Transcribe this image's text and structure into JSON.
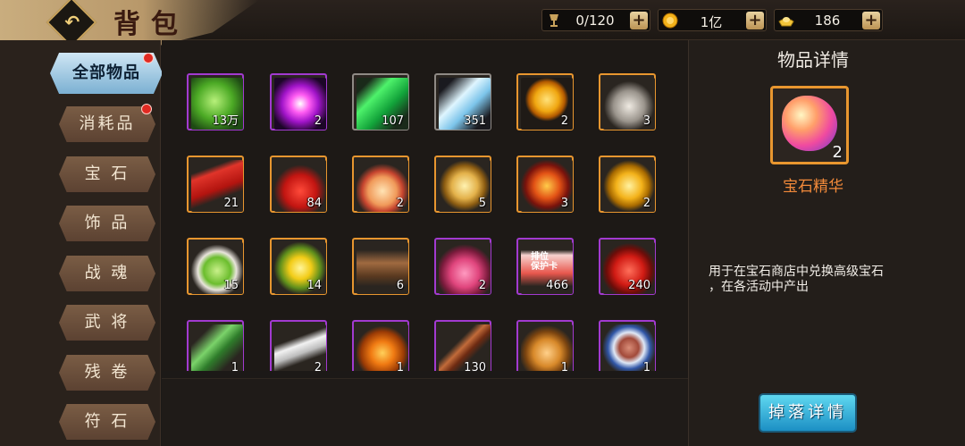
{
  "header": {
    "title": "背包",
    "back_icon": "back-arrow-icon",
    "resources": [
      {
        "icon": "trophy-icon",
        "value": "0/120",
        "color": "#c9a35c"
      },
      {
        "icon": "gold-coin-icon",
        "value": "1亿",
        "color": "#f3b21a"
      },
      {
        "icon": "ingot-icon",
        "value": "186",
        "color": "#f3c53a"
      }
    ],
    "plus_label": "+"
  },
  "sidebar": {
    "items": [
      {
        "label": "全部物品",
        "active": true,
        "badge": true
      },
      {
        "label": "消耗品",
        "active": false,
        "badge": true
      },
      {
        "label": "宝 石",
        "active": false,
        "badge": false
      },
      {
        "label": "饰 品",
        "active": false,
        "badge": false
      },
      {
        "label": "战 魂",
        "active": false,
        "badge": false
      },
      {
        "label": "武 将",
        "active": false,
        "badge": false
      },
      {
        "label": "残 卷",
        "active": false,
        "badge": false
      },
      {
        "label": "符 石",
        "active": false,
        "badge": false
      }
    ]
  },
  "inventory": {
    "rows": [
      [
        {
          "name": "green-beans-item",
          "count": "13万",
          "frame": "purple"
        },
        {
          "name": "purple-vortex-orb-item",
          "count": "2",
          "frame": "purple"
        },
        {
          "name": "green-emerald-item",
          "count": "107",
          "frame": "gray"
        },
        {
          "name": "blue-crystal-item",
          "count": "351",
          "frame": "gray"
        },
        {
          "name": "gold-medal-item",
          "count": "2",
          "frame": "orange"
        },
        {
          "name": "wine-jar-item",
          "count": "3",
          "frame": "orange"
        }
      ],
      [
        {
          "name": "couplets-item",
          "count": "21",
          "frame": "orange"
        },
        {
          "name": "firecrackers-item",
          "count": "84",
          "frame": "orange"
        },
        {
          "name": "birthday-cake-item",
          "count": "2",
          "frame": "orange"
        },
        {
          "name": "jade-pendant-item",
          "count": "5",
          "frame": "orange"
        },
        {
          "name": "dragon-lantern-item",
          "count": "3",
          "frame": "orange"
        },
        {
          "name": "chrysanthemum-item",
          "count": "2",
          "frame": "orange"
        }
      ],
      [
        {
          "name": "green-dumplings-item",
          "count": "15",
          "frame": "orange"
        },
        {
          "name": "lily-flower-item",
          "count": "14",
          "frame": "orange"
        },
        {
          "name": "shopping-cart-item",
          "count": "6",
          "frame": "orange"
        },
        {
          "name": "pink-pouch-item",
          "count": "2",
          "frame": "purple"
        },
        {
          "name": "rank-protect-card-item",
          "count": "466",
          "frame": "purple",
          "label": "排位\n保护卡"
        },
        {
          "name": "red-treasure-bag-item",
          "count": "240",
          "frame": "purple"
        }
      ],
      [
        {
          "name": "bamboo-leaves-item",
          "count": "1",
          "frame": "purple"
        },
        {
          "name": "white-sticks-item",
          "count": "2",
          "frame": "purple"
        },
        {
          "name": "jack-o-lantern-item",
          "count": "1",
          "frame": "purple"
        },
        {
          "name": "wooden-staff-item",
          "count": "130",
          "frame": "purple"
        },
        {
          "name": "roast-chicken-item",
          "count": "1",
          "frame": "purple"
        },
        {
          "name": "porridge-bowl-item",
          "count": "1",
          "frame": "purple"
        }
      ]
    ]
  },
  "detail": {
    "title": "物品详情",
    "item_icon": "gem-essence-icon",
    "item_count": "2",
    "item_name": "宝石精华",
    "description_line1": "用于在宝石商店中兑换高级宝石",
    "description_line2": "，在各活动中产出",
    "drop_button": "掉落详情"
  },
  "colors": {
    "frame_purple": "#a23ad0",
    "frame_orange": "#e8962f",
    "frame_gray": "#8f8a85",
    "name_orange": "#f28a3a"
  }
}
